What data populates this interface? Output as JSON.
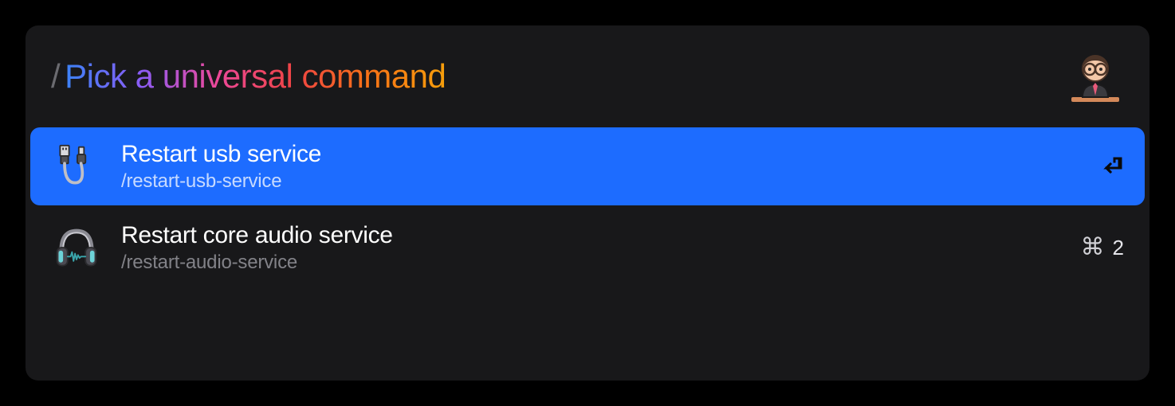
{
  "header": {
    "slash": "/",
    "prompt": "Pick a universal command"
  },
  "items": [
    {
      "icon": "usb-cable-icon",
      "title": "Restart usb service",
      "command": "/restart-usb-service",
      "selected": true,
      "accessory": {
        "type": "enter"
      }
    },
    {
      "icon": "headphones-icon",
      "title": "Restart core audio service",
      "command": "/restart-audio-service",
      "selected": false,
      "accessory": {
        "type": "shortcut",
        "cmd": "⌘",
        "key": "2"
      }
    }
  ]
}
